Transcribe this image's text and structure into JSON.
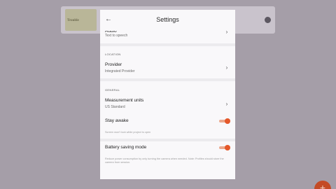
{
  "background": {
    "map_label": "Trouble",
    "fab_icon": "+"
  },
  "sheet": {
    "back_icon": "←",
    "title": "Settings",
    "partial_row": {
      "title": "Audio",
      "subtitle": "Text to speech"
    },
    "location_section": "LOCATION",
    "provider": {
      "title": "Provider",
      "subtitle": "Integrated Provider"
    },
    "general_section": "GENERAL",
    "units": {
      "title": "Measurement units",
      "subtitle": "US Standard"
    },
    "stay_awake": {
      "title": "Stay awake",
      "description": "Screen won't lock while project is open",
      "enabled": true
    },
    "battery": {
      "title": "Battery saving mode",
      "description": "Reduce power consumption by only turning the camera when needed. Note: Profiles should store the camera from session.",
      "enabled": true
    },
    "chevron": "›"
  },
  "colors": {
    "accent": "#e4582a",
    "overlay": "#a59ea8",
    "sheet": "#f9f8fa"
  }
}
